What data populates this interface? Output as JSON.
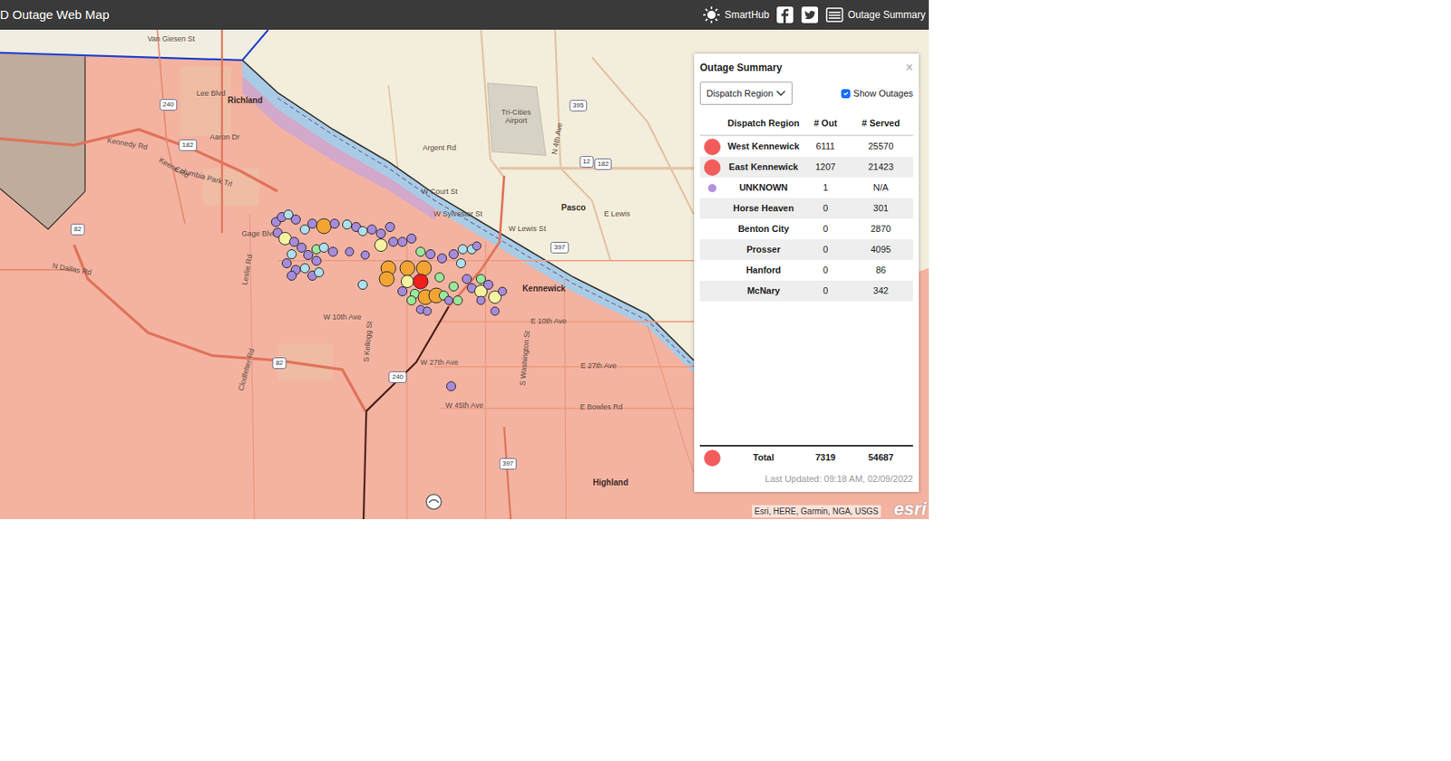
{
  "header": {
    "title": "D Outage Web Map",
    "links": [
      {
        "label": "SmartHub"
      },
      {
        "label": "Outage Summary"
      }
    ]
  },
  "map": {
    "labels": [
      {
        "text": "Van Giesen St"
      },
      {
        "text": "Richland"
      },
      {
        "text": "Lee Blvd"
      },
      {
        "text": "Aaron Dr"
      },
      {
        "text": "Kennedy Rd"
      },
      {
        "text": "Keene Rd"
      },
      {
        "text": "Columbia Park Trl"
      },
      {
        "text": "Gage Blvd"
      },
      {
        "text": "Leslie Rd"
      },
      {
        "text": "N Dallas Rd"
      },
      {
        "text": "Clodfelter Rd"
      },
      {
        "text": "Argent Rd"
      },
      {
        "text": "Tri-Cities Airport"
      },
      {
        "text": "W Court St"
      },
      {
        "text": "W Sylvester St"
      },
      {
        "text": "W Lewis St"
      },
      {
        "text": "Pasco"
      },
      {
        "text": "E Lewis"
      },
      {
        "text": "Kennewick"
      },
      {
        "text": "W 10th Ave"
      },
      {
        "text": "E 10th Ave"
      },
      {
        "text": "W 27th Ave"
      },
      {
        "text": "E 27th Ave"
      },
      {
        "text": "W 45th Ave"
      },
      {
        "text": "E Bowles Rd"
      },
      {
        "text": "Highland"
      },
      {
        "text": "N 4th Ave"
      },
      {
        "text": "S Kellogg St"
      },
      {
        "text": "S Washington St"
      }
    ],
    "shields": [
      {
        "text": "240"
      },
      {
        "text": "182"
      },
      {
        "text": "82"
      },
      {
        "text": "82"
      },
      {
        "text": "240"
      },
      {
        "text": "395"
      },
      {
        "text": "12"
      },
      {
        "text": "182"
      },
      {
        "text": "397"
      },
      {
        "text": "397"
      }
    ],
    "outages": [
      {
        "color": "#a78bdb"
      },
      {
        "color": "#a78bdb"
      },
      {
        "color": "#aee0ee"
      },
      {
        "color": "#a78bdb"
      },
      {
        "color": "#aee0ee"
      },
      {
        "color": "#a78bdb"
      },
      {
        "color": "#f3a433"
      },
      {
        "color": "#a78bdb"
      },
      {
        "color": "#aee0ee"
      },
      {
        "color": "#a78bdb"
      },
      {
        "color": "#aee0ee"
      },
      {
        "color": "#a78bdb"
      },
      {
        "color": "#a78bdb"
      },
      {
        "color": "#a78bdb"
      },
      {
        "color": "#a78bdb"
      },
      {
        "color": "#f6f3a0"
      },
      {
        "color": "#a78bdb"
      },
      {
        "color": "#a78bdb"
      },
      {
        "color": "#aee0ee"
      },
      {
        "color": "#a78bdb"
      },
      {
        "color": "#9be89b"
      },
      {
        "color": "#aee0ee"
      },
      {
        "color": "#a78bdb"
      },
      {
        "color": "#a78bdb"
      },
      {
        "color": "#a78bdb"
      },
      {
        "color": "#a78bdb"
      },
      {
        "color": "#a78bdb"
      },
      {
        "color": "#aee0ee"
      },
      {
        "color": "#a78bdb"
      },
      {
        "color": "#aee0ee"
      },
      {
        "color": "#a78bdb"
      },
      {
        "color": "#a78bdb"
      },
      {
        "color": "#f6f3a0"
      },
      {
        "color": "#a78bdb"
      },
      {
        "color": "#a78bdb"
      },
      {
        "color": "#a78bdb"
      },
      {
        "color": "#9be89b"
      },
      {
        "color": "#a78bdb"
      },
      {
        "color": "#a78bdb"
      },
      {
        "color": "#a78bdb"
      },
      {
        "color": "#aee0ee"
      },
      {
        "color": "#aee0ee"
      },
      {
        "color": "#a78bdb"
      },
      {
        "color": "#aee0ee"
      },
      {
        "color": "#aee0ee"
      },
      {
        "color": "#f3a433"
      },
      {
        "color": "#f3a433"
      },
      {
        "color": "#f3a433"
      },
      {
        "color": "#f3a433"
      },
      {
        "color": "#f6f3a0"
      },
      {
        "color": "#a78bdb"
      },
      {
        "color": "#9be89b"
      },
      {
        "color": "#f3a433"
      },
      {
        "color": "#f3a433"
      },
      {
        "color": "#9be89b"
      },
      {
        "color": "#9be89b"
      },
      {
        "color": "#a78bdb"
      },
      {
        "color": "#9be89b"
      },
      {
        "color": "#9be89b"
      },
      {
        "color": "#9be89b"
      },
      {
        "color": "#a78bdb"
      },
      {
        "color": "#f6f3a0"
      },
      {
        "color": "#f6f3a0"
      },
      {
        "color": "#a78bdb"
      },
      {
        "color": "#a78bdb"
      },
      {
        "color": "#a78bdb"
      },
      {
        "color": "#a78bdb"
      },
      {
        "color": "#a78bdb"
      },
      {
        "color": "#a78bdb"
      },
      {
        "color": "#a78bdb"
      },
      {
        "color": "#a78bdb"
      },
      {
        "color": "#9be89b"
      },
      {
        "color": "#f21d1d"
      }
    ],
    "attribution": "Esri, HERE, Garmin, NGA, USGS",
    "logo": "esri"
  },
  "panel": {
    "title": "Outage Summary",
    "close": "×",
    "group_by": "Dispatch Region",
    "show_outages": {
      "label": "Show Outages",
      "checked": true
    },
    "columns": [
      "Dispatch Region",
      "# Out",
      "# Served"
    ],
    "rows": [
      {
        "region": "West Kennewick",
        "out": "6111",
        "served": "25570",
        "kind": "outage",
        "color": "#f25c5c"
      },
      {
        "region": "East Kennewick",
        "out": "1207",
        "served": "21423",
        "kind": "outage",
        "color": "#f25c5c"
      },
      {
        "region": "UNKNOWN",
        "out": "1",
        "served": "N/A",
        "kind": "unknown",
        "color": "#b690e0"
      },
      {
        "region": "Horse Heaven",
        "out": "0",
        "served": "301",
        "kind": "clear"
      },
      {
        "region": "Benton City",
        "out": "0",
        "served": "2870",
        "kind": "clear"
      },
      {
        "region": "Prosser",
        "out": "0",
        "served": "4095",
        "kind": "clear"
      },
      {
        "region": "Hanford",
        "out": "0",
        "served": "86",
        "kind": "clear"
      },
      {
        "region": "McNary",
        "out": "0",
        "served": "342",
        "kind": "clear"
      }
    ],
    "total": {
      "label": "Total",
      "out": "7319",
      "served": "54687",
      "color": "#f25c5c"
    },
    "last_updated": "Last Updated: 09:18 AM, 02/09/2022"
  }
}
